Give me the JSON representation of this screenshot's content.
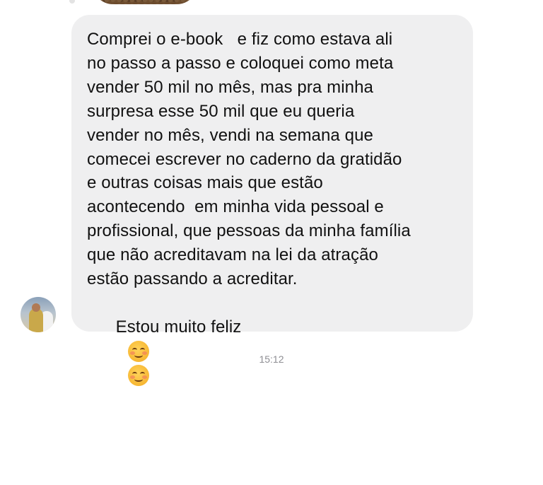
{
  "message": {
    "lines": [
      "Comprei o e-book   e fiz como estava ali",
      "no passo a passo e coloquei como meta",
      "vender 50 mil no mês, mas pra minha",
      "surpresa esse 50 mil que eu queria",
      "vender no mês, vendi na semana que",
      "comecei escrever no caderno da gratidão",
      "e outras coisas mais que estão",
      "acontecendo  em minha vida pessoal e",
      "profissional, que pessoas da minha família",
      "que não acreditavam na lei da atração",
      "estão passando a acreditar."
    ],
    "last_line": "Estou muito feliz",
    "emojis": [
      "smiling-face-with-blush-emoji",
      "smiling-face-with-blush-emoji"
    ],
    "bubble_color": "#efeff0"
  },
  "timestamp": "15:12"
}
